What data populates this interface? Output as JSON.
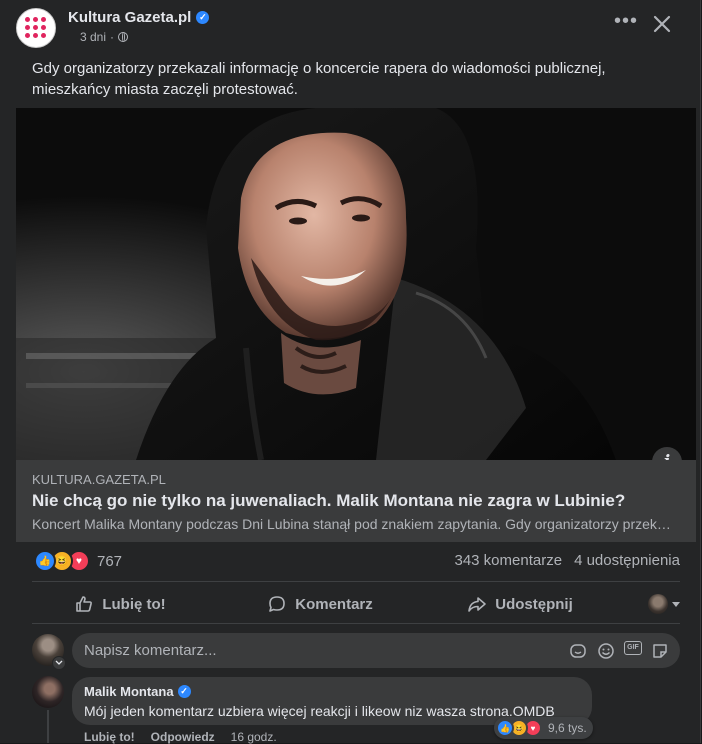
{
  "post": {
    "page_name": "Kultura Gazeta.pl",
    "time": "3 dni",
    "separator": "·",
    "text": "Gdy organizatorzy przekazali informację o koncercie rapera do wiadomości publicznej, mieszkańcy miasta zaczęli protestować."
  },
  "link": {
    "domain": "KULTURA.GAZETA.PL",
    "title": "Nie chcą go nie tylko na juwenaliach. Malik Montana nie zagra w Lubinie?",
    "description": "Koncert Malika Montany podczas Dni Lubina stanął pod znakiem zapytania. Gdy organizatorzy przekazali informację o koncercie rapera do wiadomości publicznej"
  },
  "stats": {
    "reaction_count": "767",
    "comments": "343 komentarze",
    "shares": "4 udostępnienia"
  },
  "actions": {
    "like": "Lubię to!",
    "comment": "Komentarz",
    "share": "Udostępnij"
  },
  "comment_input": {
    "placeholder": "Napisz komentarz..."
  },
  "comment": {
    "author": "Malik Montana",
    "text": "Mój jeden komentarz uzbiera więcej reakcji i likeow niz wasza strona.OMDB",
    "reaction_count": "9,6 tys.",
    "like": "Lubię to!",
    "reply": "Odpowiedz",
    "time": "16 godz."
  },
  "colors": {
    "background": "#242526",
    "link_box": "#3a3b3c",
    "accent_blue": "#2d88ff",
    "brand_logo": "#e0245e"
  },
  "icons": [
    "verified-icon",
    "globe-icon",
    "more-icon",
    "close-icon",
    "info-icon",
    "like-icon",
    "comment-icon",
    "share-icon",
    "sticker-icon",
    "emoji-icon",
    "gif-icon",
    "camera-icon"
  ]
}
